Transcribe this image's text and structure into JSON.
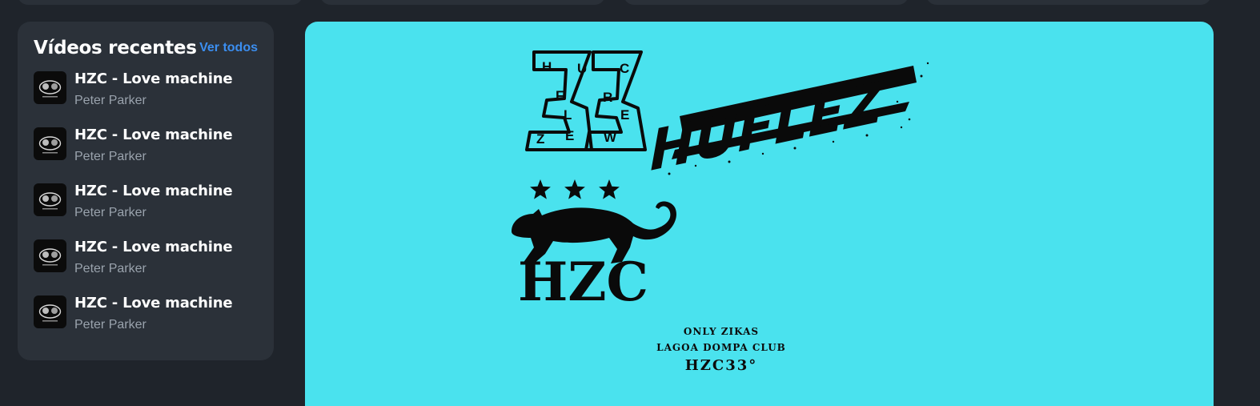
{
  "sidebar": {
    "title": "Vídeos recentes",
    "see_all_label": "Ver todos",
    "videos": [
      {
        "title": "HZC - Love machine",
        "artist": "Peter Parker"
      },
      {
        "title": "HZC - Love machine",
        "artist": "Peter Parker"
      },
      {
        "title": "HZC - Love machine",
        "artist": "Peter Parker"
      },
      {
        "title": "HZC - Love machine",
        "artist": "Peter Parker"
      },
      {
        "title": "HZC - Love machine",
        "artist": "Peter Parker"
      }
    ]
  },
  "banner": {
    "background": "#4ae2ee",
    "logo_33_letters": [
      "H",
      "U",
      "C",
      "F",
      "R",
      "L",
      "E",
      "Z",
      "E",
      "W"
    ],
    "wordmark": "HUFLEZ",
    "emblem_text": "HZC",
    "emblem_icon": "panther-icon",
    "credit_line_1": "ONLY ZIKAS",
    "credit_line_2": "LAGOA DOMPA CLUB",
    "credit_tag": "HZC33°"
  },
  "colors": {
    "page_bg": "#1f242b",
    "panel_bg": "#2b3139",
    "link": "#3b8ef0",
    "muted_text": "#9aa3ad"
  }
}
